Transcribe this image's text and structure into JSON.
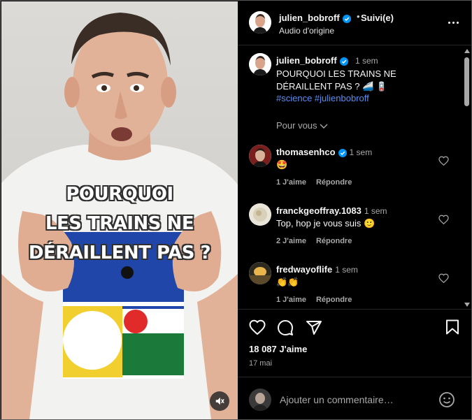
{
  "colors": {
    "background": "#000000",
    "text": "#f5f5f5",
    "muted": "#a8a8a8",
    "link": "#5b8ef5",
    "verified": "#0095f6"
  },
  "video": {
    "overlay_lines": [
      "POURQUOI",
      "LES TRAINS NE",
      "DÉRAILLENT PAS ?"
    ],
    "mute_icon": "speaker-muted-icon"
  },
  "header": {
    "username": "julien_bobroff",
    "separator": "•",
    "follow_label": "Suivi(e)",
    "subtitle": "Audio d'origine",
    "more_icon": "more-options-icon"
  },
  "caption": {
    "username": "julien_bobroff",
    "time": "1 sem",
    "text": "POURQUOI LES TRAINS NE DÉRAILLENT PAS ? 🚄 🪫",
    "tags": "#science #julienbobroff"
  },
  "for_you": "Pour vous",
  "comments": [
    {
      "username": "thomasenhco",
      "verified": true,
      "time": "1 sem",
      "text": "🤩",
      "likes": "1 J'aime",
      "reply": "Répondre"
    },
    {
      "username": "franckgeoffray.1083",
      "verified": false,
      "time": "1 sem",
      "text": "Top, hop je vous suis 🙂",
      "likes": "2 J'aime",
      "reply": "Répondre"
    },
    {
      "username": "fredwayoflife",
      "verified": false,
      "time": "1 sem",
      "text": "👏👏",
      "likes": "1 J'aime",
      "reply": "Répondre"
    }
  ],
  "stats": {
    "likes": "18 087 J'aime",
    "date": "17 mai"
  },
  "add_comment": {
    "placeholder": "Ajouter un commentaire…"
  }
}
